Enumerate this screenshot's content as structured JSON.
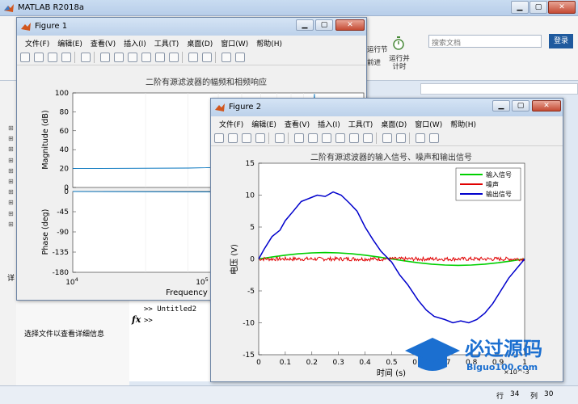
{
  "main_window": {
    "title": "MATLAB R2018a",
    "search_placeholder": "搜索文档",
    "login_label": "登录",
    "ribbon": {
      "run_section_label": "运行节",
      "advance_label": "前进",
      "run_time_label": "运行并计时"
    },
    "file_panel_hint": "选择文件以查看详细信息",
    "detail_tab": "详",
    "command_window_lines": [
      ">> Untitled2",
      ">>"
    ],
    "fx_label": "fx",
    "status": {
      "row_label": "行",
      "row_value": "34",
      "col_label": "列",
      "col_value": "30"
    }
  },
  "figure1": {
    "title": "Figure 1",
    "menu": [
      "文件(F)",
      "编辑(E)",
      "查看(V)",
      "插入(I)",
      "工具(T)",
      "桌面(D)",
      "窗口(W)",
      "帮助(H)"
    ],
    "plot_title": "二阶有源滤波器的幅频和相频响应",
    "mag_ylabel": "Magnitude (dB)",
    "phase_ylabel": "Phase (deg)",
    "xlabel": "Frequency",
    "mag_yticks": [
      "100",
      "80",
      "60",
      "40",
      "20",
      "0"
    ],
    "phase_yticks": [
      "0",
      "-45",
      "-90",
      "-135",
      "-180"
    ]
  },
  "figure2": {
    "title": "Figure 2",
    "menu": [
      "文件(F)",
      "编辑(E)",
      "查看(V)",
      "插入(I)",
      "工具(T)",
      "桌面(D)",
      "窗口(W)",
      "帮助(H)"
    ]
  },
  "colors": {
    "input": "#00d000",
    "noise": "#e00000",
    "output": "#0000cc"
  },
  "chart_data": [
    {
      "type": "line",
      "title": "二阶有源滤波器的幅频和相频响应",
      "xlabel": "Frequency",
      "ylabel": "Magnitude (dB)",
      "x_scale": "log",
      "xlim": [
        10000,
        160000
      ],
      "ylim": [
        0,
        100
      ],
      "x_tick_labels": [
        "10^4",
        "10^5"
      ],
      "series": [
        {
          "x": [
            10000,
            30000,
            60000,
            80000,
            90000,
            96000,
            100000,
            101000,
            104000,
            110000,
            125000,
            160000
          ],
          "values": [
            20,
            20.5,
            22,
            25,
            30,
            40,
            99,
            55,
            30,
            18,
            10,
            4
          ]
        }
      ]
    },
    {
      "type": "line",
      "ylabel": "Phase (deg)",
      "x_scale": "log",
      "xlim": [
        10000,
        160000
      ],
      "ylim": [
        -180,
        0
      ],
      "series": [
        {
          "x": [
            10000,
            99000,
            100000,
            100500,
            160000
          ],
          "values": [
            0,
            -2,
            -90,
            -178,
            -180
          ]
        }
      ]
    },
    {
      "type": "line",
      "title": "二阶有源滤波器的输入信号、噪声和输出信号",
      "xlabel": "时间 (s)",
      "ylabel": "电压 (V)",
      "x_multiplier": "×10^-3",
      "xlim": [
        0,
        1
      ],
      "ylim": [
        -15,
        15
      ],
      "x_ticks": [
        "0",
        "0.1",
        "0.2",
        "0.3",
        "0.4",
        "0.5",
        "0.6",
        "0.7",
        "0.8",
        "0.9",
        "1"
      ],
      "y_ticks": [
        "15",
        "10",
        "5",
        "0",
        "-5",
        "-10",
        "-15"
      ],
      "legend_position": "top-right",
      "series": [
        {
          "name": "输入信号",
          "x": [
            0,
            0.05,
            0.1,
            0.15,
            0.2,
            0.25,
            0.3,
            0.35,
            0.4,
            0.45,
            0.5,
            0.55,
            0.6,
            0.65,
            0.7,
            0.75,
            0.8,
            0.85,
            0.9,
            0.95,
            1
          ],
          "values": [
            0,
            0.31,
            0.59,
            0.81,
            0.95,
            1,
            0.95,
            0.81,
            0.59,
            0.31,
            0,
            -0.31,
            -0.59,
            -0.81,
            -0.95,
            -1,
            -0.95,
            -0.81,
            -0.59,
            -0.31,
            0
          ]
        },
        {
          "name": "噪声",
          "x": [
            0,
            1
          ],
          "values": [
            0,
            0
          ],
          "noise_amplitude": 0.3
        },
        {
          "name": "输出信号",
          "x": [
            0,
            0.02,
            0.05,
            0.08,
            0.1,
            0.13,
            0.16,
            0.19,
            0.22,
            0.25,
            0.28,
            0.31,
            0.34,
            0.37,
            0.4,
            0.43,
            0.46,
            0.5,
            0.53,
            0.56,
            0.6,
            0.63,
            0.66,
            0.7,
            0.73,
            0.76,
            0.79,
            0.82,
            0.85,
            0.88,
            0.91,
            0.94,
            0.97,
            1
          ],
          "values": [
            0,
            1.5,
            3.5,
            4.5,
            6,
            7.5,
            9,
            9.5,
            10,
            9.8,
            10.5,
            10,
            8.8,
            7.5,
            5,
            3,
            1.2,
            -0.5,
            -2.5,
            -4,
            -6.5,
            -8,
            -9,
            -9.5,
            -10,
            -9.7,
            -10,
            -9.5,
            -8.5,
            -7,
            -5,
            -3,
            -1.5,
            0
          ]
        }
      ]
    }
  ]
}
